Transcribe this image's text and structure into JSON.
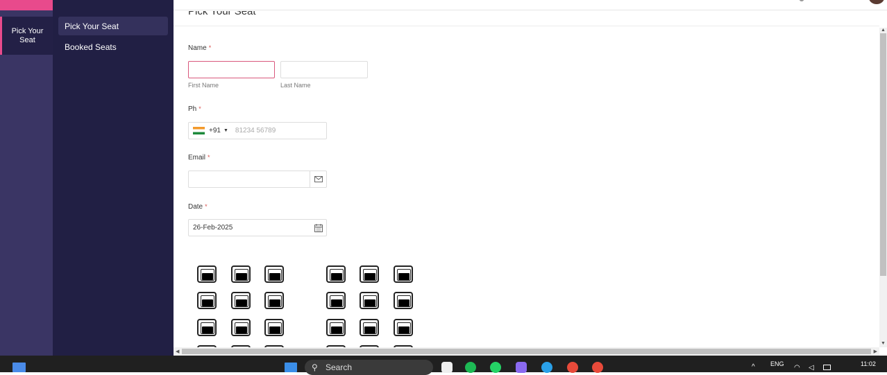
{
  "rail": {
    "item_label": "Pick Your Seat"
  },
  "subnav": {
    "items": [
      {
        "label": "Pick Your Seat"
      },
      {
        "label": "Booked Seats"
      }
    ]
  },
  "page": {
    "title": "Pick Your Seat"
  },
  "form": {
    "name": {
      "label": "Name",
      "required_mark": "*",
      "first_sub": "First Name",
      "last_sub": "Last Name",
      "first_value": "",
      "last_value": ""
    },
    "phone": {
      "label": "Ph",
      "required_mark": "*",
      "country_code": "+91",
      "placeholder": "81234 56789"
    },
    "email": {
      "label": "Email",
      "required_mark": "*",
      "value": "",
      "icon": "envelope-icon"
    },
    "date": {
      "label": "Date",
      "required_mark": "*",
      "value": "26-Feb-2025",
      "icon": "calendar-icon"
    }
  },
  "taskbar": {
    "search_label": "Search",
    "lang": "ENG",
    "time": "11:02"
  },
  "colors": {
    "accent": "#e84a8c",
    "rail": "#3a3564",
    "subnav": "#211f44"
  }
}
